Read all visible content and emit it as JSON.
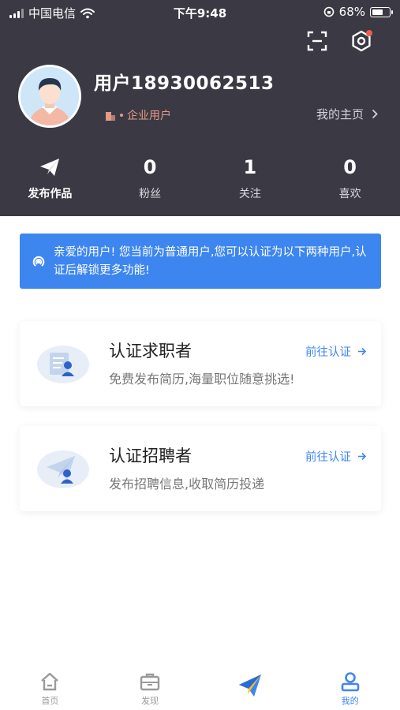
{
  "status_bar": {
    "carrier": "中国电信",
    "time": "下午9:48",
    "battery": "68%",
    "battery_level": 0.68
  },
  "profile": {
    "username": "用户18930062513",
    "user_type": "企业用户",
    "homepage_link": "我的主页"
  },
  "stats": [
    {
      "label": "发布作品"
    },
    {
      "value": "0",
      "label": "粉丝"
    },
    {
      "value": "1",
      "label": "关注"
    },
    {
      "value": "0",
      "label": "喜欢"
    }
  ],
  "notice": {
    "text": "亲爱的用户! 您当前为普通用户,您可以认证为以下两种用户,认证后解锁更多功能!"
  },
  "cards": [
    {
      "title": "认证求职者",
      "desc": "免费发布简历,海量职位随意挑选!",
      "link": "前往认证"
    },
    {
      "title": "认证招聘者",
      "desc": "发布招聘信息,收取简历投递",
      "link": "前往认证"
    }
  ],
  "tabbar": {
    "items": [
      {
        "label": "首页",
        "icon": "home-icon"
      },
      {
        "label": "发现",
        "icon": "briefcase-icon"
      },
      {
        "label": "",
        "icon": "paper-plane-icon"
      },
      {
        "label": "我的",
        "icon": "user-icon"
      }
    ],
    "active": 3
  },
  "colors": {
    "header_bg": "#3b3a44",
    "accent": "#3d86f0",
    "user_type": "#e59a86",
    "badge": "#f25b4f"
  }
}
